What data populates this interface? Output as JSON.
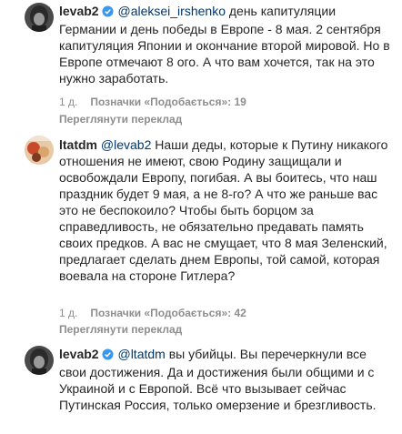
{
  "comments": [
    {
      "username": "levab2",
      "verified": true,
      "mention": "@aleksei_irshenko",
      "text": " день капитуляции Германии и день победы в Европе - 8 мая. 2 сентября капитуляция Японии и окончание второй мировой. Но в Европе отмечают 8 ого. А что вам хочется, так на это нужно заработать.",
      "time": "1 д.",
      "likes": "Позначки «Подобається»: 19",
      "translate": "Переглянути переклад"
    },
    {
      "username": "ltatdm",
      "verified": false,
      "mention": "@levab2",
      "text": " Наши деды, которые к Путину никакого отношения не имеют, свою Родину защищали и освобождали Европу, погибая. А вы боитесь, что наш праздник будет 9 мая, а не 8-го? А что же раньше вас это не беспокоило? Чтобы быть борцом за справедливость, не обязательно предавать память своих предков. А вас не смущает, что 8 мая Зеленский, предлагает сделать днем Европы, той самой, которая воевала на стороне Гитлера?",
      "time": "1 д.",
      "likes": "Позначки «Подобається»: 42",
      "translate": "Переглянути переклад"
    },
    {
      "username": "levab2",
      "verified": true,
      "mention": "@ltatdm",
      "text": " вы убийцы. Вы перечеркнули все свои достижения. Да и достижения были общими и с Украиной и с Европой. Всё что вызывает сейчас Путинская Россия, только омерзение и брезгливость."
    }
  ],
  "colors": {
    "text": "#262626",
    "mention": "#00376b",
    "meta": "#8e8e8e",
    "verified": "#3897f0"
  }
}
